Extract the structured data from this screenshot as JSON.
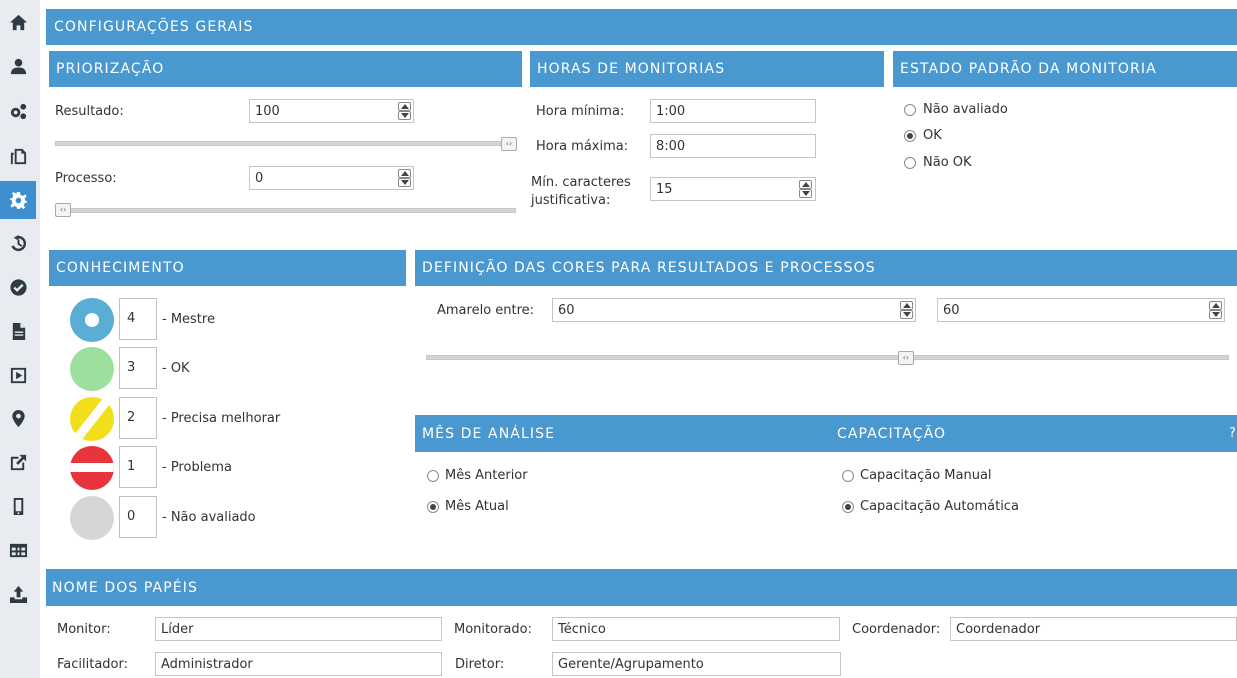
{
  "sidebar": {
    "items": [
      {
        "icon": "home-icon"
      },
      {
        "icon": "user-icon"
      },
      {
        "icon": "gears-icon"
      },
      {
        "icon": "copy-icon"
      },
      {
        "icon": "settings-icon",
        "active": true
      },
      {
        "icon": "history-icon"
      },
      {
        "icon": "check-circle-icon"
      },
      {
        "icon": "document-icon"
      },
      {
        "icon": "play-icon"
      },
      {
        "icon": "map-marker-icon"
      },
      {
        "icon": "external-link-icon"
      },
      {
        "icon": "mobile-icon"
      },
      {
        "icon": "table-icon"
      },
      {
        "icon": "upload-icon"
      }
    ]
  },
  "main_title": "CONFIGURAÇÕES GERAIS",
  "priorizacao": {
    "title": "PRIORIZAÇÃO",
    "resultado_label": "Resultado:",
    "resultado_value": "100",
    "resultado_slider": 1.0,
    "processo_label": "Processo:",
    "processo_value": "0",
    "processo_slider": 0.0
  },
  "horas": {
    "title": "HORAS DE MONITORIAS",
    "min_label": "Hora mínima:",
    "min_value": "1:00",
    "max_label": "Hora máxima:",
    "max_value": "8:00",
    "chars_label_1": "Mín. caracteres",
    "chars_label_2": "justificativa:",
    "chars_value": "15"
  },
  "estado": {
    "title": "ESTADO PADRÃO DA MONITORIA",
    "options": [
      "Não avaliado",
      "OK",
      "Não OK"
    ],
    "selected": "OK"
  },
  "conhecimento": {
    "title": "CONHECIMENTO",
    "levels": [
      {
        "value": "4",
        "label": "- Mestre",
        "icon": "mestre-icon"
      },
      {
        "value": "3",
        "label": "- OK",
        "icon": "ok-icon"
      },
      {
        "value": "2",
        "label": "- Precisa melhorar",
        "icon": "precisa-melhorar-icon"
      },
      {
        "value": "1",
        "label": "- Problema",
        "icon": "problema-icon"
      },
      {
        "value": "0",
        "label": "- Não avaliado",
        "icon": "nao-avaliado-icon"
      }
    ],
    "colors": {
      "mestre": "#5aaed5",
      "ok": "#9ddf9c",
      "amarelo": "#f2de1a",
      "vermelho": "#e8353c",
      "cinza": "#d6d6d6"
    }
  },
  "cores": {
    "title": "DEFINIÇÃO DAS CORES PARA RESULTADOS E PROCESSOS",
    "amarelo_label": "Amarelo entre:",
    "value_a": "60",
    "value_b": "60",
    "slider_position": 0.6
  },
  "mes": {
    "title": "MÊS DE ANÁLISE",
    "options": [
      "Mês Anterior",
      "Mês Atual"
    ],
    "selected": "Mês Atual"
  },
  "capacitacao": {
    "title": "CAPACITAÇÃO",
    "help": "?",
    "options": [
      "Capacitação Manual",
      "Capacitação Automática"
    ],
    "selected": "Capacitação Automática"
  },
  "papeis": {
    "title": "NOME DOS PAPÉIS",
    "monitor_label": "Monitor:",
    "monitor_value": "Líder",
    "monitorado_label": "Monitorado:",
    "monitorado_value": "Técnico",
    "coordenador_label": "Coordenador:",
    "coordenador_value": "Coordenador",
    "facilitador_label": "Facilitador:",
    "facilitador_value": "Administrador",
    "diretor_label": "Diretor:",
    "diretor_value": "Gerente/Agrupamento"
  },
  "accent_color": "#4a98d0"
}
